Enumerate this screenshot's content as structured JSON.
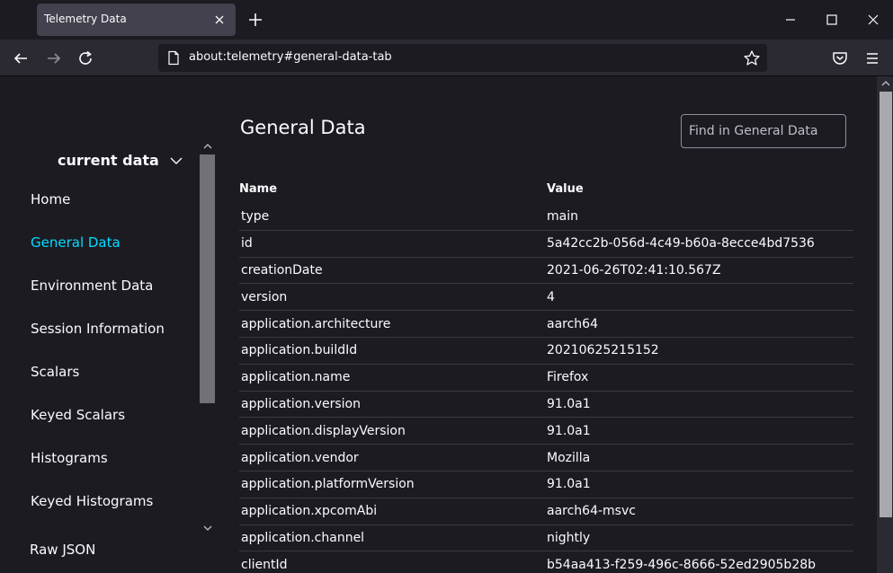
{
  "window": {
    "tab_title": "Telemetry Data"
  },
  "navbar": {
    "url": "about:telemetry#general-data-tab"
  },
  "sidebar": {
    "heading": "current data",
    "items": [
      {
        "label": "Home"
      },
      {
        "label": "General Data",
        "active": true
      },
      {
        "label": "Environment Data"
      },
      {
        "label": "Session Information"
      },
      {
        "label": "Scalars"
      },
      {
        "label": "Keyed Scalars"
      },
      {
        "label": "Histograms"
      },
      {
        "label": "Keyed Histograms"
      }
    ],
    "raw_json": "Raw JSON"
  },
  "main": {
    "title": "General Data",
    "search_placeholder": "Find in General Data",
    "columns": {
      "name": "Name",
      "value": "Value"
    },
    "rows": [
      {
        "name": "type",
        "value": "main"
      },
      {
        "name": "id",
        "value": "5a42cc2b-056d-4c49-b60a-8ecce4bd7536"
      },
      {
        "name": "creationDate",
        "value": "2021-06-26T02:41:10.567Z"
      },
      {
        "name": "version",
        "value": "4"
      },
      {
        "name": "application.architecture",
        "value": "aarch64"
      },
      {
        "name": "application.buildId",
        "value": "20210625215152"
      },
      {
        "name": "application.name",
        "value": "Firefox"
      },
      {
        "name": "application.version",
        "value": "91.0a1"
      },
      {
        "name": "application.displayVersion",
        "value": "91.0a1"
      },
      {
        "name": "application.vendor",
        "value": "Mozilla"
      },
      {
        "name": "application.platformVersion",
        "value": "91.0a1"
      },
      {
        "name": "application.xpcomAbi",
        "value": "aarch64-msvc"
      },
      {
        "name": "application.channel",
        "value": "nightly"
      },
      {
        "name": "clientId",
        "value": "b54aa413-f259-496c-8666-52ed2905b28b"
      }
    ]
  },
  "colors": {
    "accent": "#00ddff",
    "background": "#1c1b22",
    "toolbar": "#2b2a33",
    "tab": "#42414d"
  }
}
